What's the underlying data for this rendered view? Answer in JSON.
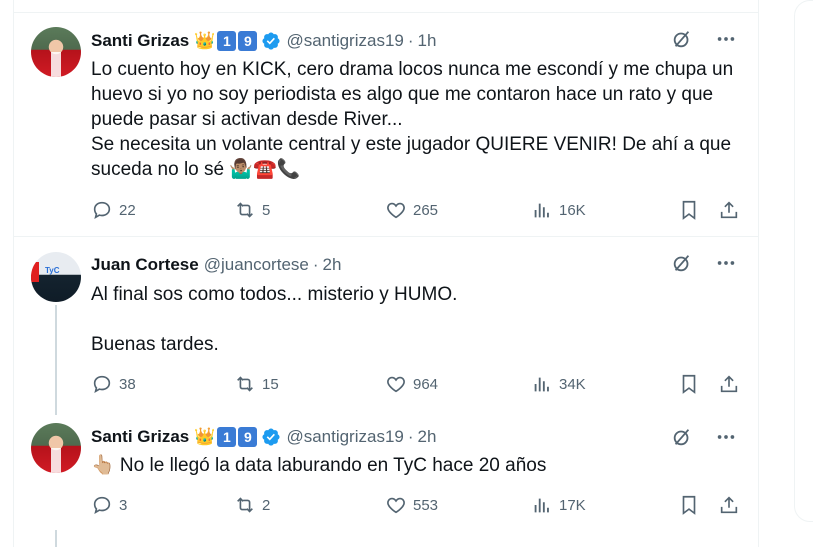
{
  "tweets": [
    {
      "name": "Santi Grizas",
      "badges": [
        "👑",
        "1",
        "9"
      ],
      "handle": "@santigrizas19",
      "time": "1h",
      "text": "Lo cuento hoy en KICK, cero drama locos nunca me escondí y me chupa un huevo si yo no soy periodista es algo que me contaron hace un rato y que puede pasar si activan desde River...\nSe necesita un volante central y este jugador QUIERE VENIR! De ahí a que suceda no lo sé 🤷🏽‍♂️☎️📞",
      "replies": "22",
      "retweets": "5",
      "likes": "265",
      "views": "16K"
    },
    {
      "name": "Juan Cortese",
      "handle": "@juancortese",
      "time": "2h",
      "text": "Al final sos como todos... misterio y HUMO.\n\nBuenas tardes.",
      "replies": "38",
      "retweets": "15",
      "likes": "964",
      "views": "34K"
    },
    {
      "name": "Santi Grizas",
      "badges": [
        "👑",
        "1",
        "9"
      ],
      "handle": "@santigrizas19",
      "time": "2h",
      "text": "👆🏼 No le llegó la data laburando en TyC hace 20 años",
      "replies": "3",
      "retweets": "2",
      "likes": "553",
      "views": "17K"
    }
  ],
  "colors": {
    "verified": "#1d9bf0",
    "muted": "#536471",
    "text": "#0f1419",
    "badge": "#3a7bd5"
  },
  "icons": [
    "grok-icon",
    "more-icon",
    "reply-icon",
    "retweet-icon",
    "like-icon",
    "views-icon",
    "bookmark-icon",
    "share-icon",
    "verified-icon"
  ]
}
